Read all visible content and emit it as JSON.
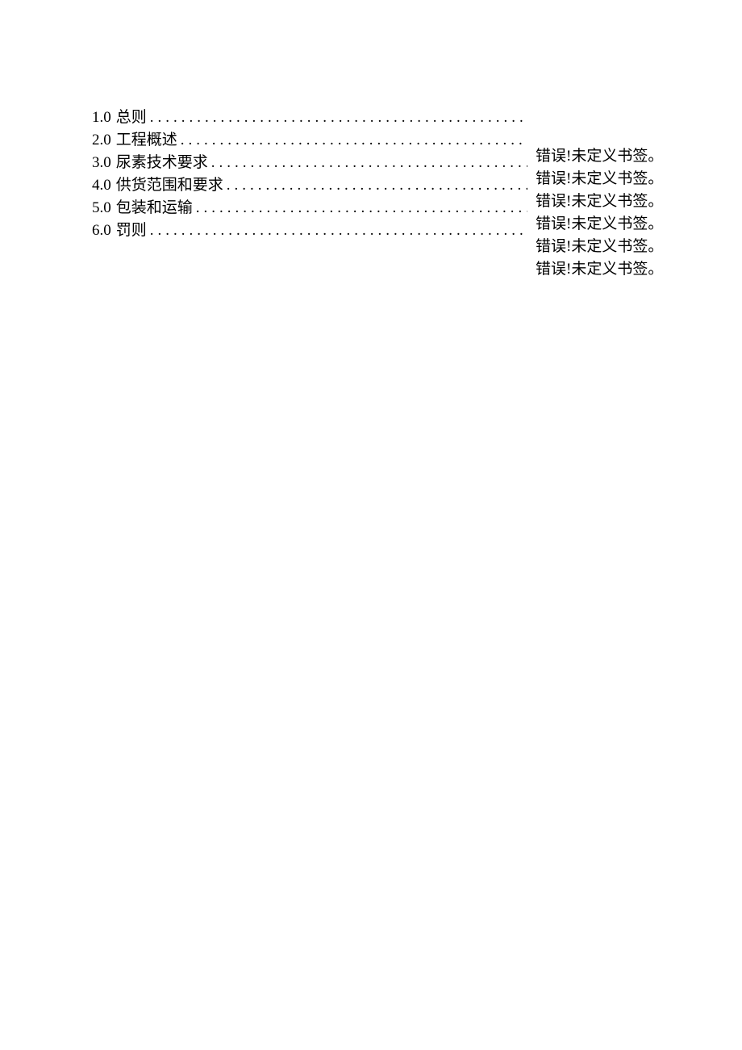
{
  "dots": "................................................................................",
  "toc": [
    {
      "num": "1.0",
      "label": "总则"
    },
    {
      "num": "2.0",
      "label": "工程概述"
    },
    {
      "num": "3.0",
      "label": "尿素技术要求"
    },
    {
      "num": "4.0",
      "label": "供货范围和要求"
    },
    {
      "num": "5.0",
      "label": "包装和运输"
    },
    {
      "num": "6.0",
      "label": "罚则"
    }
  ],
  "errors": [
    "错误!未定义书签。",
    "错误!未定义书签。",
    "错误!未定义书签。",
    "错误!未定义书签。",
    "错误!未定义书签。",
    "错误!未定义书签。"
  ]
}
